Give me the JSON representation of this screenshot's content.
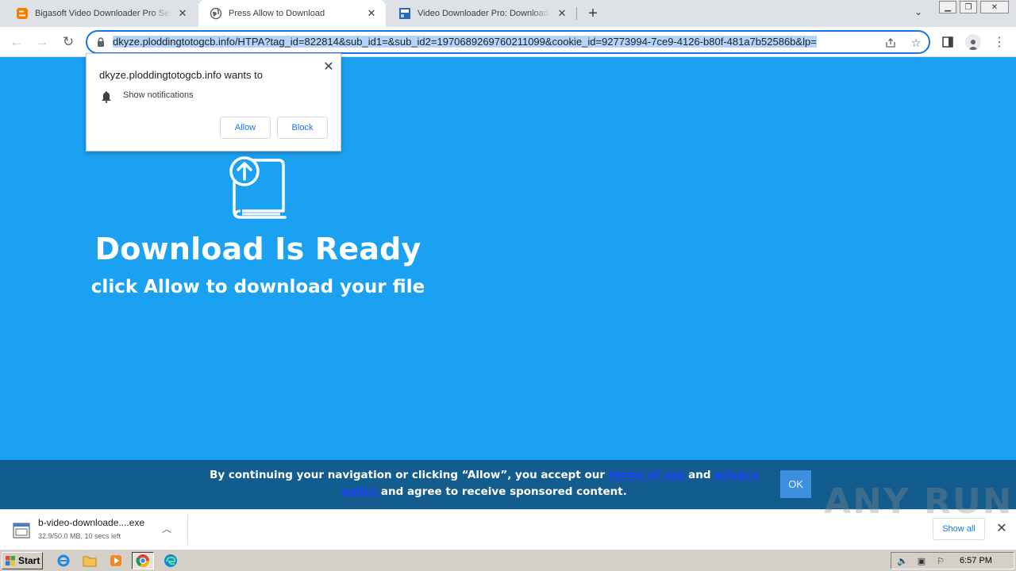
{
  "browser": {
    "tabs": [
      {
        "title": "Bigasoft Video Downloader Pro Serial",
        "favicon": "blogger-icon",
        "active": false
      },
      {
        "title": "Press Allow to Download",
        "favicon": "globe-icon",
        "active": true
      },
      {
        "title": "Video Downloader Pro: Download and",
        "favicon": "site-icon",
        "active": false
      }
    ],
    "new_tab_label": "+",
    "url": "dkyze.ploddingtotogcb.info/HTPA?tag_id=822814&sub_id1=&sub_id2=1970689269760211099&cookie_id=92773994-7ce9-4126-b80f-481a7b52586b&lp="
  },
  "permission_popup": {
    "origin_text": "dkyze.ploddingtotogcb.info wants to",
    "permission": "Show notifications",
    "allow_label": "Allow",
    "block_label": "Block"
  },
  "page": {
    "headline": "Download Is Ready",
    "subline": "click Allow to download your file",
    "consent": {
      "text_before": "By continuing your navigation or clicking “Allow”, you accept our ",
      "terms_link": "terms of use ",
      "and_text": "and ",
      "privacy_link": "privacy policy ",
      "text_after": "and agree to receive sponsored content.",
      "ok_label": "OK"
    },
    "colors": {
      "background": "#1ba1f2",
      "consent_bar": "#135c8e",
      "ok_button": "#3d8fe0"
    }
  },
  "download_shelf": {
    "filename": "b-video-downloade....exe",
    "status": "32.9/50.0 MB, 10 secs left",
    "show_all_label": "Show all",
    "watermark": "ANY RUN"
  },
  "taskbar": {
    "start_label": "Start",
    "clock": "6:57 PM"
  }
}
